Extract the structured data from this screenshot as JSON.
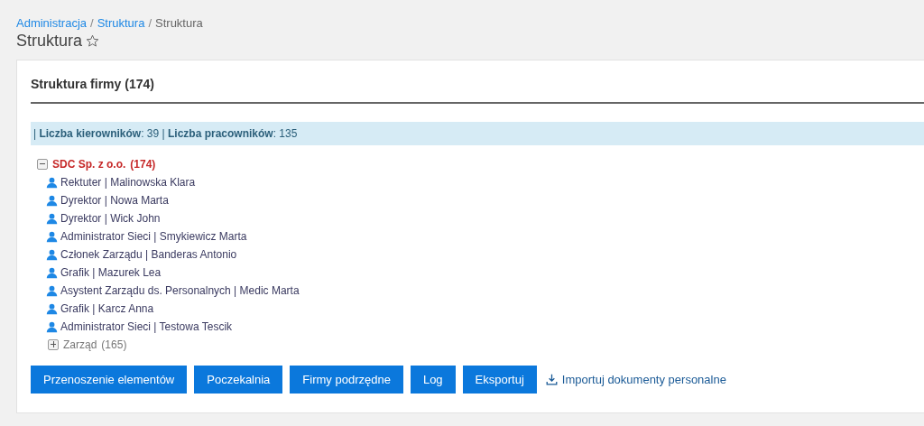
{
  "breadcrumb": [
    {
      "kind": "link",
      "label": "Administracja"
    },
    {
      "kind": "separator",
      "label": "/"
    },
    {
      "kind": "link",
      "label": "Struktura"
    },
    {
      "kind": "separator",
      "label": "/"
    },
    {
      "kind": "current",
      "label": "Struktura"
    }
  ],
  "page_title": "Struktura",
  "card": {
    "title": "Struktura firmy (174)",
    "stats": "| **Liczba kierowników**: 39 | **Liczba pracowników**: 135",
    "tree": [
      {
        "kind": "group",
        "label": "SDC Sp. z o.o.",
        "count": "(174)",
        "expanded": true,
        "children": [
          {
            "kind": "person",
            "label": "Rektuter | Malinowska Klara"
          },
          {
            "kind": "person",
            "label": "Dyrektor | Nowa Marta"
          },
          {
            "kind": "person",
            "label": "Dyrektor | Wick John"
          },
          {
            "kind": "person",
            "label": "Administrator Sieci | Smykiewicz Marta"
          },
          {
            "kind": "person",
            "label": "Członek Zarządu | Banderas Antonio"
          },
          {
            "kind": "person",
            "label": "Grafik | Mazurek Lea"
          },
          {
            "kind": "person",
            "label": "Asystent Zarządu ds. Personalnych | Medic Marta"
          },
          {
            "kind": "person",
            "label": "Grafik | Karcz Anna"
          },
          {
            "kind": "person",
            "label": "Administrator Sieci | Testowa Tescik"
          },
          {
            "kind": "group",
            "label": "Zarząd",
            "count": "(165)",
            "expanded": false
          }
        ]
      }
    ],
    "buttons": [
      "Przenoszenie elementów",
      "Poczekalnia",
      "Firmy podrzędne",
      "Log",
      "Eksportuj"
    ],
    "import_link": "Importuj dokumenty personalne"
  }
}
